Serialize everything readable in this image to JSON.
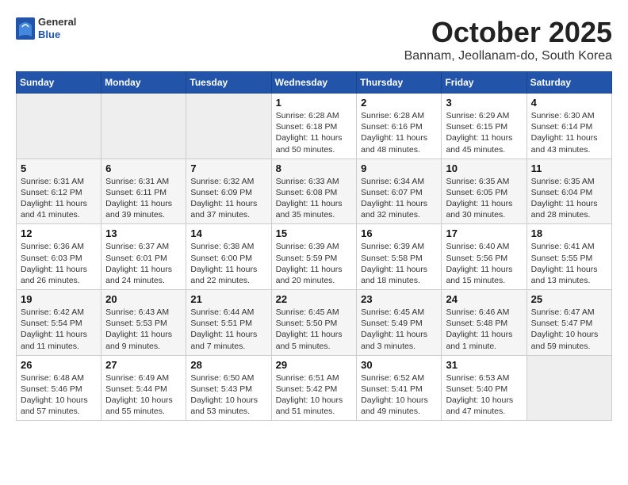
{
  "header": {
    "logo_general": "General",
    "logo_blue": "Blue",
    "month_title": "October 2025",
    "location": "Bannam, Jeollanam-do, South Korea"
  },
  "days_of_week": [
    "Sunday",
    "Monday",
    "Tuesday",
    "Wednesday",
    "Thursday",
    "Friday",
    "Saturday"
  ],
  "weeks": [
    [
      {
        "day": "",
        "info": ""
      },
      {
        "day": "",
        "info": ""
      },
      {
        "day": "",
        "info": ""
      },
      {
        "day": "1",
        "info": "Sunrise: 6:28 AM\nSunset: 6:18 PM\nDaylight: 11 hours\nand 50 minutes."
      },
      {
        "day": "2",
        "info": "Sunrise: 6:28 AM\nSunset: 6:16 PM\nDaylight: 11 hours\nand 48 minutes."
      },
      {
        "day": "3",
        "info": "Sunrise: 6:29 AM\nSunset: 6:15 PM\nDaylight: 11 hours\nand 45 minutes."
      },
      {
        "day": "4",
        "info": "Sunrise: 6:30 AM\nSunset: 6:14 PM\nDaylight: 11 hours\nand 43 minutes."
      }
    ],
    [
      {
        "day": "5",
        "info": "Sunrise: 6:31 AM\nSunset: 6:12 PM\nDaylight: 11 hours\nand 41 minutes."
      },
      {
        "day": "6",
        "info": "Sunrise: 6:31 AM\nSunset: 6:11 PM\nDaylight: 11 hours\nand 39 minutes."
      },
      {
        "day": "7",
        "info": "Sunrise: 6:32 AM\nSunset: 6:09 PM\nDaylight: 11 hours\nand 37 minutes."
      },
      {
        "day": "8",
        "info": "Sunrise: 6:33 AM\nSunset: 6:08 PM\nDaylight: 11 hours\nand 35 minutes."
      },
      {
        "day": "9",
        "info": "Sunrise: 6:34 AM\nSunset: 6:07 PM\nDaylight: 11 hours\nand 32 minutes."
      },
      {
        "day": "10",
        "info": "Sunrise: 6:35 AM\nSunset: 6:05 PM\nDaylight: 11 hours\nand 30 minutes."
      },
      {
        "day": "11",
        "info": "Sunrise: 6:35 AM\nSunset: 6:04 PM\nDaylight: 11 hours\nand 28 minutes."
      }
    ],
    [
      {
        "day": "12",
        "info": "Sunrise: 6:36 AM\nSunset: 6:03 PM\nDaylight: 11 hours\nand 26 minutes."
      },
      {
        "day": "13",
        "info": "Sunrise: 6:37 AM\nSunset: 6:01 PM\nDaylight: 11 hours\nand 24 minutes."
      },
      {
        "day": "14",
        "info": "Sunrise: 6:38 AM\nSunset: 6:00 PM\nDaylight: 11 hours\nand 22 minutes."
      },
      {
        "day": "15",
        "info": "Sunrise: 6:39 AM\nSunset: 5:59 PM\nDaylight: 11 hours\nand 20 minutes."
      },
      {
        "day": "16",
        "info": "Sunrise: 6:39 AM\nSunset: 5:58 PM\nDaylight: 11 hours\nand 18 minutes."
      },
      {
        "day": "17",
        "info": "Sunrise: 6:40 AM\nSunset: 5:56 PM\nDaylight: 11 hours\nand 15 minutes."
      },
      {
        "day": "18",
        "info": "Sunrise: 6:41 AM\nSunset: 5:55 PM\nDaylight: 11 hours\nand 13 minutes."
      }
    ],
    [
      {
        "day": "19",
        "info": "Sunrise: 6:42 AM\nSunset: 5:54 PM\nDaylight: 11 hours\nand 11 minutes."
      },
      {
        "day": "20",
        "info": "Sunrise: 6:43 AM\nSunset: 5:53 PM\nDaylight: 11 hours\nand 9 minutes."
      },
      {
        "day": "21",
        "info": "Sunrise: 6:44 AM\nSunset: 5:51 PM\nDaylight: 11 hours\nand 7 minutes."
      },
      {
        "day": "22",
        "info": "Sunrise: 6:45 AM\nSunset: 5:50 PM\nDaylight: 11 hours\nand 5 minutes."
      },
      {
        "day": "23",
        "info": "Sunrise: 6:45 AM\nSunset: 5:49 PM\nDaylight: 11 hours\nand 3 minutes."
      },
      {
        "day": "24",
        "info": "Sunrise: 6:46 AM\nSunset: 5:48 PM\nDaylight: 11 hours\nand 1 minute."
      },
      {
        "day": "25",
        "info": "Sunrise: 6:47 AM\nSunset: 5:47 PM\nDaylight: 10 hours\nand 59 minutes."
      }
    ],
    [
      {
        "day": "26",
        "info": "Sunrise: 6:48 AM\nSunset: 5:46 PM\nDaylight: 10 hours\nand 57 minutes."
      },
      {
        "day": "27",
        "info": "Sunrise: 6:49 AM\nSunset: 5:44 PM\nDaylight: 10 hours\nand 55 minutes."
      },
      {
        "day": "28",
        "info": "Sunrise: 6:50 AM\nSunset: 5:43 PM\nDaylight: 10 hours\nand 53 minutes."
      },
      {
        "day": "29",
        "info": "Sunrise: 6:51 AM\nSunset: 5:42 PM\nDaylight: 10 hours\nand 51 minutes."
      },
      {
        "day": "30",
        "info": "Sunrise: 6:52 AM\nSunset: 5:41 PM\nDaylight: 10 hours\nand 49 minutes."
      },
      {
        "day": "31",
        "info": "Sunrise: 6:53 AM\nSunset: 5:40 PM\nDaylight: 10 hours\nand 47 minutes."
      },
      {
        "day": "",
        "info": ""
      }
    ]
  ]
}
